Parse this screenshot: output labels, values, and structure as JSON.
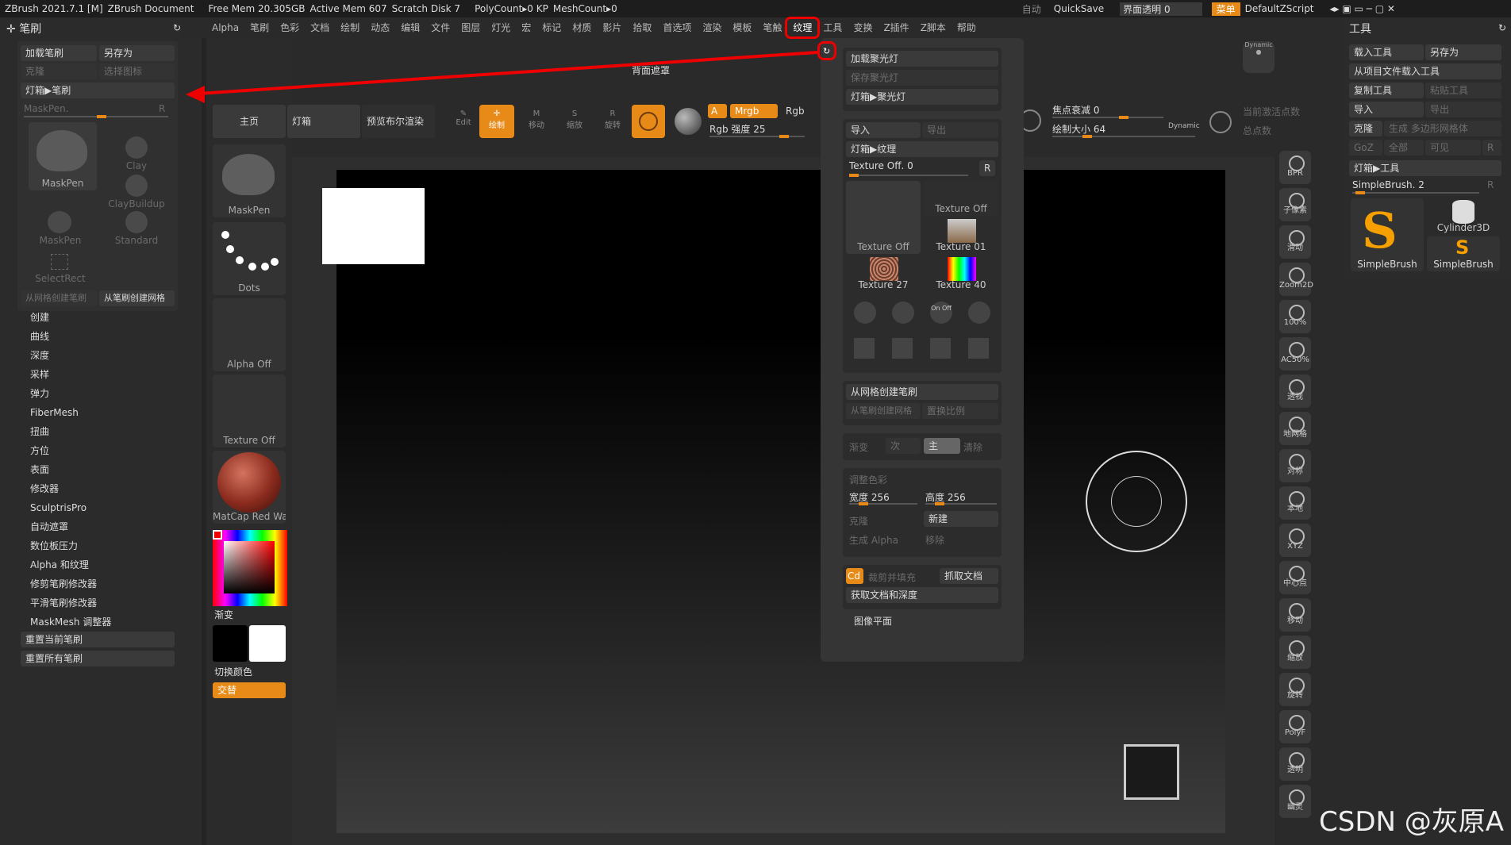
{
  "topbar": {
    "app_title": "ZBrush 2021.7.1 [M]",
    "document": "ZBrush Document",
    "free_mem": "Free Mem 20.305GB",
    "active_mem": "Active Mem 607",
    "scratch": "Scratch Disk 7",
    "polycount": "PolyCount▸0 KP",
    "meshcount": "MeshCount▸0",
    "auto": "自动",
    "quicksave": "QuickSave",
    "ui_transparency": "界面透明 0",
    "menu": "菜单",
    "script": "DefaultZScript"
  },
  "menubar": [
    "Alpha",
    "笔刷",
    "色彩",
    "文档",
    "绘制",
    "动态",
    "编辑",
    "文件",
    "图层",
    "灯光",
    "宏",
    "标记",
    "材质",
    "影片",
    "拾取",
    "首选项",
    "渲染",
    "模板",
    "笔触",
    "纹理",
    "工具",
    "变换",
    "Z插件",
    "Z脚本",
    "帮助"
  ],
  "brush_panel": {
    "title": "笔刷",
    "load": "加载笔刷",
    "save_as": "另存为",
    "clone": "克隆",
    "select_icon": "选择图标",
    "lightbox": "灯箱▶笔刷",
    "current": "MaskPen.",
    "r": "R",
    "brushes": [
      "MaskPen",
      "Clay",
      "ClayBuildup",
      "MaskPen",
      "Standard",
      "SelectRect"
    ],
    "from_mesh": "从网格创建笔刷",
    "create_mesh": "从笔刷创建网格",
    "sections": [
      "创建",
      "曲线",
      "深度",
      "采样",
      "弹力",
      "FiberMesh",
      "扭曲",
      "方位",
      "表面",
      "修改器",
      "SculptrisPro",
      "自动遮罩",
      "数位板压力",
      "Alpha 和纹理",
      "修剪笔刷修改器",
      "平滑笔刷修改器",
      "MaskMesh 调整器"
    ],
    "reset_current": "重置当前笔刷",
    "reset_all": "重置所有笔刷"
  },
  "shelf": {
    "home": "主页",
    "lightbox": "灯箱",
    "preview_bpr": "预览布尔渲染",
    "back_mask": "背面遮罩",
    "edit": "Edit",
    "draw": "绘制",
    "move": "移动",
    "scale": "缩放",
    "rotate": "旋转",
    "a": "A",
    "mrgb": "Mrgb",
    "rgb": "Rgb",
    "rgb_intensity": "Rgb 强度 25",
    "focal": "焦点衰减 0",
    "draw_size": "绘制大小 64",
    "dynamic": "Dynamic",
    "active_points": "当前激活点数",
    "total_points": "总点数"
  },
  "left_column": {
    "maskpen": "MaskPen",
    "dots": "Dots",
    "alpha_off": "Alpha Off",
    "texture_off": "Texture Off",
    "matcap": "MatCap Red Wax",
    "gradient": "渐变",
    "switch_color": "切换颜色",
    "alternate": "交替"
  },
  "texture_popup": {
    "load_spotlight": "加载聚光灯",
    "save_spotlight": "保存聚光灯",
    "lightbox_spotlight": "灯箱▶聚光灯",
    "import": "导入",
    "export": "导出",
    "lightbox_texture": "灯箱▶纹理",
    "texture_off_slider": "Texture Off. 0",
    "r": "R",
    "thumbs": [
      "Texture Off",
      "Texture Off",
      "Texture 01",
      "Texture 27",
      "Texture 40"
    ],
    "from_mesh_brush": "从网格创建笔刷",
    "from_brush_mesh": "从笔刷创建网格",
    "replace_ratio": "置换比例",
    "gradient": "渐变",
    "next": "次",
    "main": "主",
    "clear": "清除",
    "adjust_color": "调整色彩",
    "width": "宽度 256",
    "height": "高度 256",
    "clone": "克隆",
    "new": "新建",
    "make_alpha": "生成 Alpha",
    "remove": "移除",
    "cd": "Cd",
    "crop_fill": "裁剪并填充",
    "grab_doc": "抓取文档",
    "grab_doc_depth": "获取文档和深度",
    "image_plane": "图像平面"
  },
  "tool_panel": {
    "title": "工具",
    "load": "载入工具",
    "save_as": "另存为",
    "load_from_project": "从项目文件载入工具",
    "copy": "复制工具",
    "paste": "粘贴工具",
    "import": "导入",
    "export": "导出",
    "clone": "克隆",
    "make_polymesh": "生成 多边形网格体",
    "goz": "GoZ",
    "all": "全部",
    "visible": "可见",
    "r": "R",
    "lightbox": "灯箱▶工具",
    "current": "SimpleBrush. 2",
    "tools": [
      "SimpleBrush",
      "Cylinder3D",
      "SimpleBrush"
    ]
  },
  "right_strip": [
    "BPR",
    "子像素",
    "滑动",
    "Zoom2D",
    "100%",
    "AC50%",
    "透视",
    "地网格",
    "对称",
    "本地",
    "XYZ",
    "中心点",
    "移动",
    "缩放",
    "旋转",
    "PolyF",
    "透明",
    "幽灵"
  ],
  "watermark": "CSDN @灰原A",
  "colors": {
    "accent": "#e88a17",
    "highlight": "#e00000"
  }
}
